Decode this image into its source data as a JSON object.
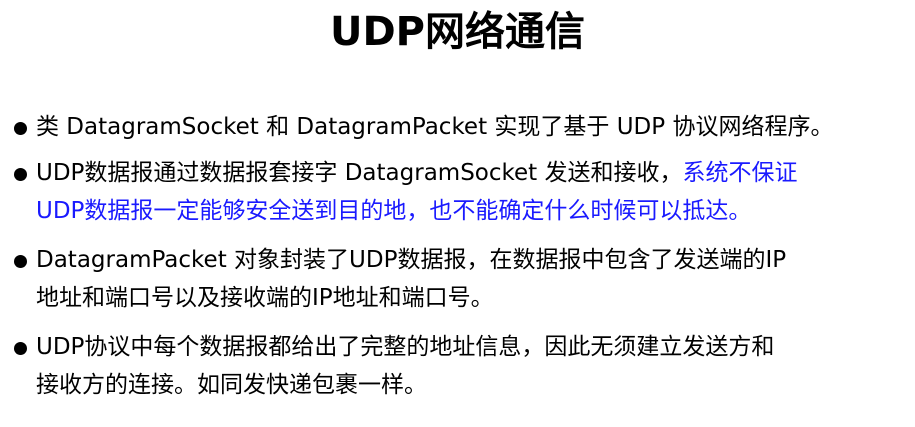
{
  "slide": {
    "title": "UDP网络通信",
    "bullets": [
      {
        "lines": [
          {
            "text": "类 DatagramSocket 和 DatagramPacket 实现了基于 UDP 协议网络程序。"
          }
        ]
      },
      {
        "line1_plain": "UDP数据报通过数据报套接字 DatagramSocket 发送和接收，",
        "line1_highlight": "系统不保证",
        "line2_highlight": "UDP数据报一定能够安全送到目的地，也不能确定什么时候可以抵达。"
      },
      {
        "lines": [
          {
            "text": "DatagramPacket 对象封装了UDP数据报，在数据报中包含了发送端的IP"
          },
          {
            "text": "地址和端口号以及接收端的IP地址和端口号。"
          }
        ]
      },
      {
        "lines": [
          {
            "text": "UDP协议中每个数据报都给出了完整的地址信息，因此无须建立发送方和"
          },
          {
            "text": "接收方的连接。如同发快递包裹一样。"
          }
        ]
      }
    ],
    "colors": {
      "text": "#000000",
      "highlight": "#1a1aff",
      "background": "#ffffff"
    }
  }
}
